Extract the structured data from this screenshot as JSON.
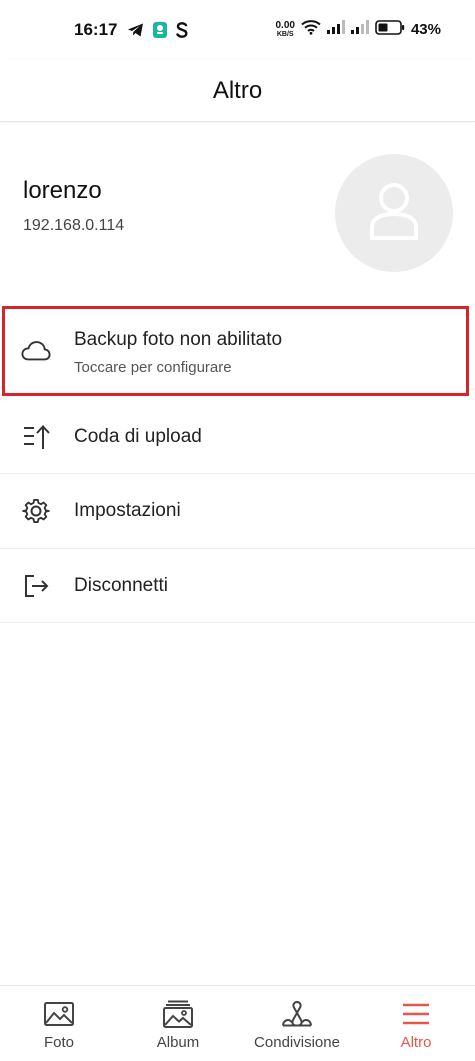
{
  "status_bar": {
    "time": "16:17",
    "net_speed_value": "0.00",
    "net_speed_unit": "KB/S",
    "battery_percent": "43%",
    "left_icons": [
      "telegram-icon",
      "app-notification-icon",
      "s-app-icon"
    ],
    "right_icons": [
      "wifi-icon",
      "signal-icon",
      "signal-icon-2",
      "battery-icon"
    ]
  },
  "header": {
    "title": "Altro"
  },
  "profile": {
    "username": "lorenzo",
    "ip": "192.168.0.114",
    "avatar_icon": "user-placeholder-icon"
  },
  "menu": {
    "backup": {
      "label": "Backup foto non abilitato",
      "sub": "Toccare per configurare",
      "icon": "cloud-icon",
      "highlight_color": "#d8232a"
    },
    "upload_queue": {
      "label": "Coda di upload",
      "icon": "upload-queue-icon"
    },
    "settings": {
      "label": "Impostazioni",
      "icon": "gear-icon"
    },
    "logout": {
      "label": "Disconnetti",
      "icon": "logout-icon"
    }
  },
  "bottom_nav": {
    "items": [
      {
        "label": "Foto",
        "icon": "photo-icon",
        "active": false
      },
      {
        "label": "Album",
        "icon": "album-icon",
        "active": false
      },
      {
        "label": "Condivisione",
        "icon": "share-icon",
        "active": false
      },
      {
        "label": "Altro",
        "icon": "menu-icon",
        "active": true
      }
    ],
    "active_color": "#e5574a"
  }
}
